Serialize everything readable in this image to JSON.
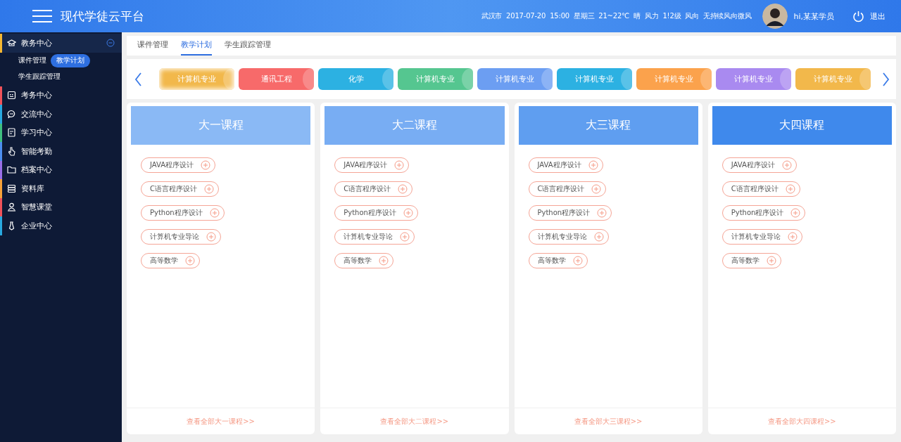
{
  "header": {
    "title": "现代学徒云平台",
    "weather": "武汉市  2017-07-20  15:00  星期三  21~22℃  晴  风力  1!2级  风向  无持续风向微风",
    "user": "hi,某某学员",
    "logout": "退出"
  },
  "sidebar": {
    "items": [
      {
        "label": "教务中心",
        "color": "#f5b731",
        "expanded": true,
        "children": [
          {
            "label": "课件管理",
            "selected": false
          },
          {
            "label": "教学计划",
            "selected": true
          },
          {
            "label": "学生跟踪管理",
            "selected": false
          }
        ]
      },
      {
        "label": "考务中心",
        "color": "#f0525a",
        "expanded": false
      },
      {
        "label": "交流中心",
        "color": "#29a9e0",
        "expanded": false
      },
      {
        "label": "学习中心",
        "color": "#3fbf7f",
        "expanded": false
      },
      {
        "label": "智能考勤",
        "color": "#4d8ff0",
        "expanded": false
      },
      {
        "label": "档案中心",
        "color": "#9a6fe8",
        "expanded": false
      },
      {
        "label": "资料库",
        "color": "#f7a23a",
        "expanded": false
      },
      {
        "label": "智慧课堂",
        "color": "#f0525a",
        "expanded": false
      },
      {
        "label": "企业中心",
        "color": "#29a9e0",
        "expanded": false
      }
    ]
  },
  "tabs": [
    {
      "label": "课件管理",
      "selected": false
    },
    {
      "label": "教学计划",
      "selected": true
    },
    {
      "label": "学生跟踪管理",
      "selected": false
    }
  ],
  "majors": [
    {
      "label": "计算机专业",
      "color": "#f2b84b",
      "selected": true
    },
    {
      "label": "通讯工程",
      "color": "#f76a6a",
      "selected": false
    },
    {
      "label": "化学",
      "color": "#2cb1e2",
      "selected": false
    },
    {
      "label": "计算机专业",
      "color": "#55c690",
      "selected": false
    },
    {
      "label": "计算机专业",
      "color": "#6c9ef2",
      "selected": false
    },
    {
      "label": "计算机专业",
      "color": "#2cb1e2",
      "selected": false
    },
    {
      "label": "计算机专业",
      "color": "#fba24c",
      "selected": false
    },
    {
      "label": "计算机专业",
      "color": "#a98af0",
      "selected": false
    },
    {
      "label": "计算机专业",
      "color": "#f2b84b",
      "selected": false
    }
  ],
  "years": [
    {
      "title": "大一课程",
      "color": "#8ab9f5",
      "courses": [
        "JAVA程序设计",
        "C语言程序设计",
        "Python程序设计",
        "计算机专业导论",
        "高等数学"
      ],
      "more": "查看全部大一课程>>"
    },
    {
      "title": "大二课程",
      "color": "#78adf3",
      "courses": [
        "JAVA程序设计",
        "C语言程序设计",
        "Python程序设计",
        "计算机专业导论",
        "高等数学"
      ],
      "more": "查看全部大二课程>>"
    },
    {
      "title": "大三课程",
      "color": "#5f9ef0",
      "courses": [
        "JAVA程序设计",
        "C语言程序设计",
        "Python程序设计",
        "计算机专业导论",
        "高等数学"
      ],
      "more": "查看全部大三课程>>"
    },
    {
      "title": "大四课程",
      "color": "#3f89ec",
      "courses": [
        "JAVA程序设计",
        "C语言程序设计",
        "Python程序设计",
        "计算机专业导论",
        "高等数学"
      ],
      "more": "查看全部大四课程>>"
    }
  ]
}
